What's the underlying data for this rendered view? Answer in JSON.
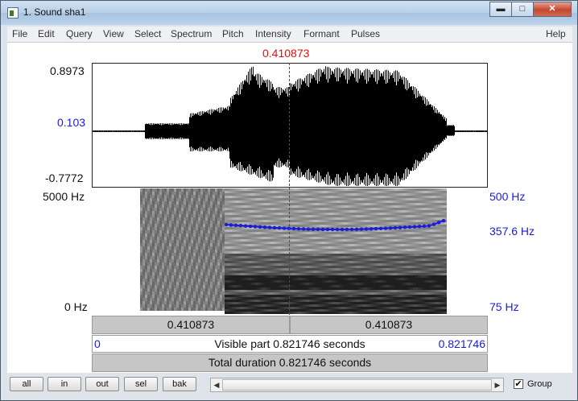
{
  "window": {
    "title": "1. Sound sha1",
    "minimize": "▬",
    "maximize": "□",
    "close": "✕"
  },
  "menu": [
    "File",
    "Edit",
    "Query",
    "View",
    "Select",
    "Spectrum",
    "Pitch",
    "Intensity",
    "Formant",
    "Pulses",
    "Help"
  ],
  "cursor_time": "0.410873",
  "waveform": {
    "max_label": "0.8973",
    "zero_label": "0.103",
    "min_label": "-0.7772"
  },
  "spectrogram": {
    "top_freq": "5000 Hz",
    "bottom_freq": "0 Hz",
    "pitch_top": "500 Hz",
    "pitch_current": "357.6 Hz",
    "pitch_bottom": "75 Hz"
  },
  "bars": {
    "left_segment": "0.410873",
    "right_segment": "0.410873",
    "visible_start": "0",
    "visible_part": "Visible part 0.821746 seconds",
    "visible_end": "0.821746",
    "total": "Total duration 0.821746 seconds"
  },
  "buttons": {
    "all": "all",
    "in": "in",
    "out": "out",
    "sel": "sel",
    "bak": "bak"
  },
  "scroll": {
    "left_arrow": "◀",
    "right_arrow": "▶"
  },
  "group": {
    "label": "Group",
    "checked": "✔"
  },
  "colors": {
    "cursor": "#e01010",
    "pitch": "#1c1cd8",
    "waveform": "#000000"
  }
}
